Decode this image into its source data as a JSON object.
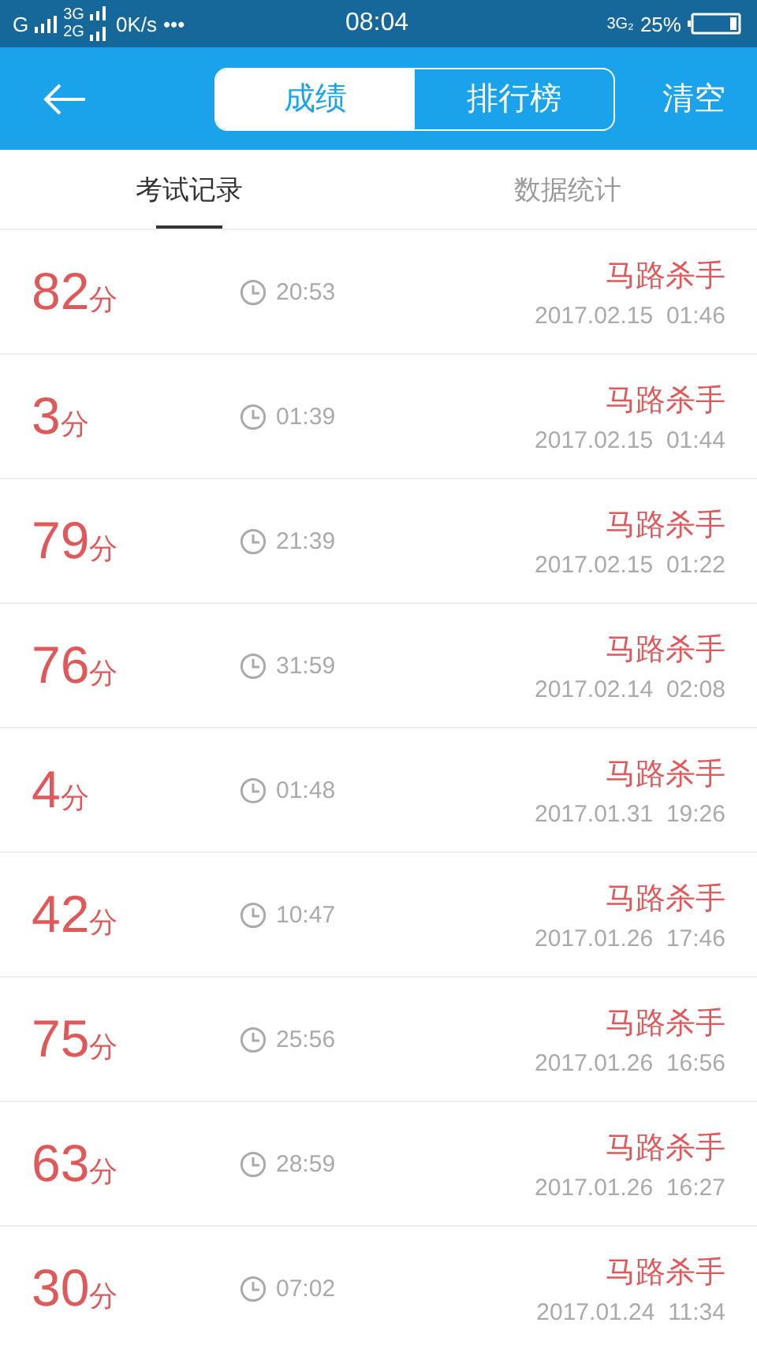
{
  "status_bar": {
    "network_1": "G",
    "network_2": "3G",
    "network_3": "2G",
    "speed": "0K/s",
    "more": "•••",
    "time": "08:04",
    "network_4": "3G₂",
    "battery": "25%"
  },
  "header": {
    "segments": [
      {
        "label": "成绩",
        "selected": true
      },
      {
        "label": "排行榜",
        "selected": false
      }
    ],
    "action": "清空"
  },
  "tabs": [
    {
      "label": "考试记录",
      "selected": true
    },
    {
      "label": "数据统计",
      "selected": false
    }
  ],
  "records": [
    {
      "score": "82",
      "unit": "分",
      "duration": "20:53",
      "title": "马路杀手",
      "date": "2017.02.15  01:46"
    },
    {
      "score": "3",
      "unit": "分",
      "duration": "01:39",
      "title": "马路杀手",
      "date": "2017.02.15  01:44"
    },
    {
      "score": "79",
      "unit": "分",
      "duration": "21:39",
      "title": "马路杀手",
      "date": "2017.02.15  01:22"
    },
    {
      "score": "76",
      "unit": "分",
      "duration": "31:59",
      "title": "马路杀手",
      "date": "2017.02.14  02:08"
    },
    {
      "score": "4",
      "unit": "分",
      "duration": "01:48",
      "title": "马路杀手",
      "date": "2017.01.31  19:26"
    },
    {
      "score": "42",
      "unit": "分",
      "duration": "10:47",
      "title": "马路杀手",
      "date": "2017.01.26  17:46"
    },
    {
      "score": "75",
      "unit": "分",
      "duration": "25:56",
      "title": "马路杀手",
      "date": "2017.01.26  16:56"
    },
    {
      "score": "63",
      "unit": "分",
      "duration": "28:59",
      "title": "马路杀手",
      "date": "2017.01.26  16:27"
    },
    {
      "score": "30",
      "unit": "分",
      "duration": "07:02",
      "title": "马路杀手",
      "date": "2017.01.24  11:34"
    }
  ]
}
